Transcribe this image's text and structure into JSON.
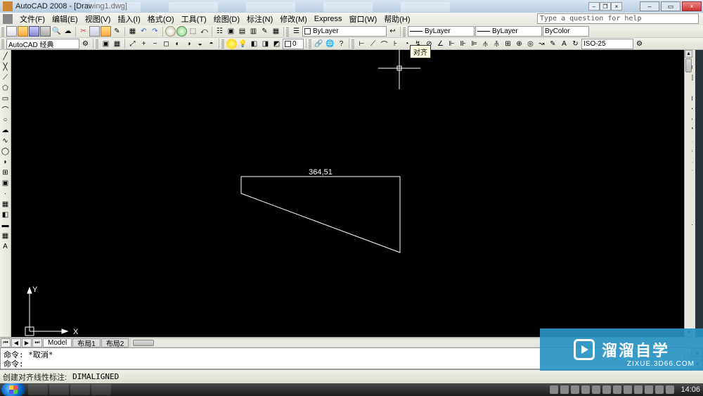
{
  "title": "AutoCAD 2008 - [Drawing1.dwg]",
  "menu": [
    "文件(F)",
    "编辑(E)",
    "视图(V)",
    "插入(I)",
    "格式(O)",
    "工具(T)",
    "绘图(D)",
    "标注(N)",
    "修改(M)",
    "Express",
    "窗口(W)",
    "帮助(H)"
  ],
  "help_placeholder": "Type a question for help",
  "workspace": "AutoCAD 经典",
  "layer_current": "0",
  "layer_combo": "ByLayer",
  "linetype": "ByLayer",
  "lineweight": "ByLayer",
  "color": "ByColor",
  "dimstyle": "ISO-25",
  "tooltip": "对齐",
  "dimension_value": "364,51",
  "tabs": {
    "model": "Model",
    "layouts": [
      "布局1",
      "布局2"
    ]
  },
  "cmd": {
    "line1": "命令: *取消*",
    "line2": "命令:"
  },
  "status": {
    "hint": "创建对齐线性标注:",
    "cmd": "DIMALIGNED"
  },
  "clock": "14:06",
  "watermark": {
    "brand": "溜溜自学",
    "url": "ZIXUE.3D66.COM"
  },
  "ucs": {
    "x": "X",
    "y": "Y"
  }
}
